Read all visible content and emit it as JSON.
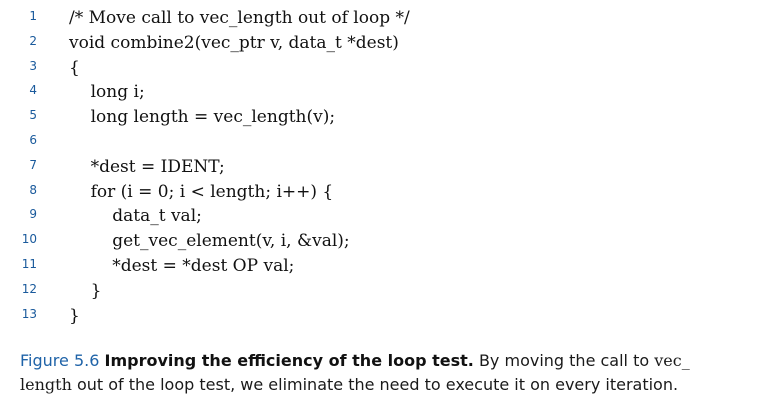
{
  "code": {
    "lines": [
      {
        "number": "1",
        "text": "/* Move call to vec_length out of loop */"
      },
      {
        "number": "2",
        "text": "void combine2(vec_ptr v, data_t *dest)"
      },
      {
        "number": "3",
        "text": "{"
      },
      {
        "number": "4",
        "text": "    long i;"
      },
      {
        "number": "5",
        "text": "    long length = vec_length(v);"
      },
      {
        "number": "6",
        "text": ""
      },
      {
        "number": "7",
        "text": "    *dest = IDENT;"
      },
      {
        "number": "8",
        "text": "    for (i = 0; i < length; i++) {"
      },
      {
        "number": "9",
        "text": "        data_t val;"
      },
      {
        "number": "10",
        "text": "        get_vec_element(v, i, &val);"
      },
      {
        "number": "11",
        "text": "        *dest = *dest OP val;"
      },
      {
        "number": "12",
        "text": "    }"
      },
      {
        "number": "13",
        "text": "}"
      }
    ]
  },
  "caption": {
    "label": "Figure 5.6",
    "title": "Improving the efficiency of the loop test.",
    "text_before": " By moving the call to ",
    "code_part1": "vec_",
    "code_part2": "length",
    "text_after": " out of the loop test, we eliminate the need to execute it on every iteration."
  }
}
